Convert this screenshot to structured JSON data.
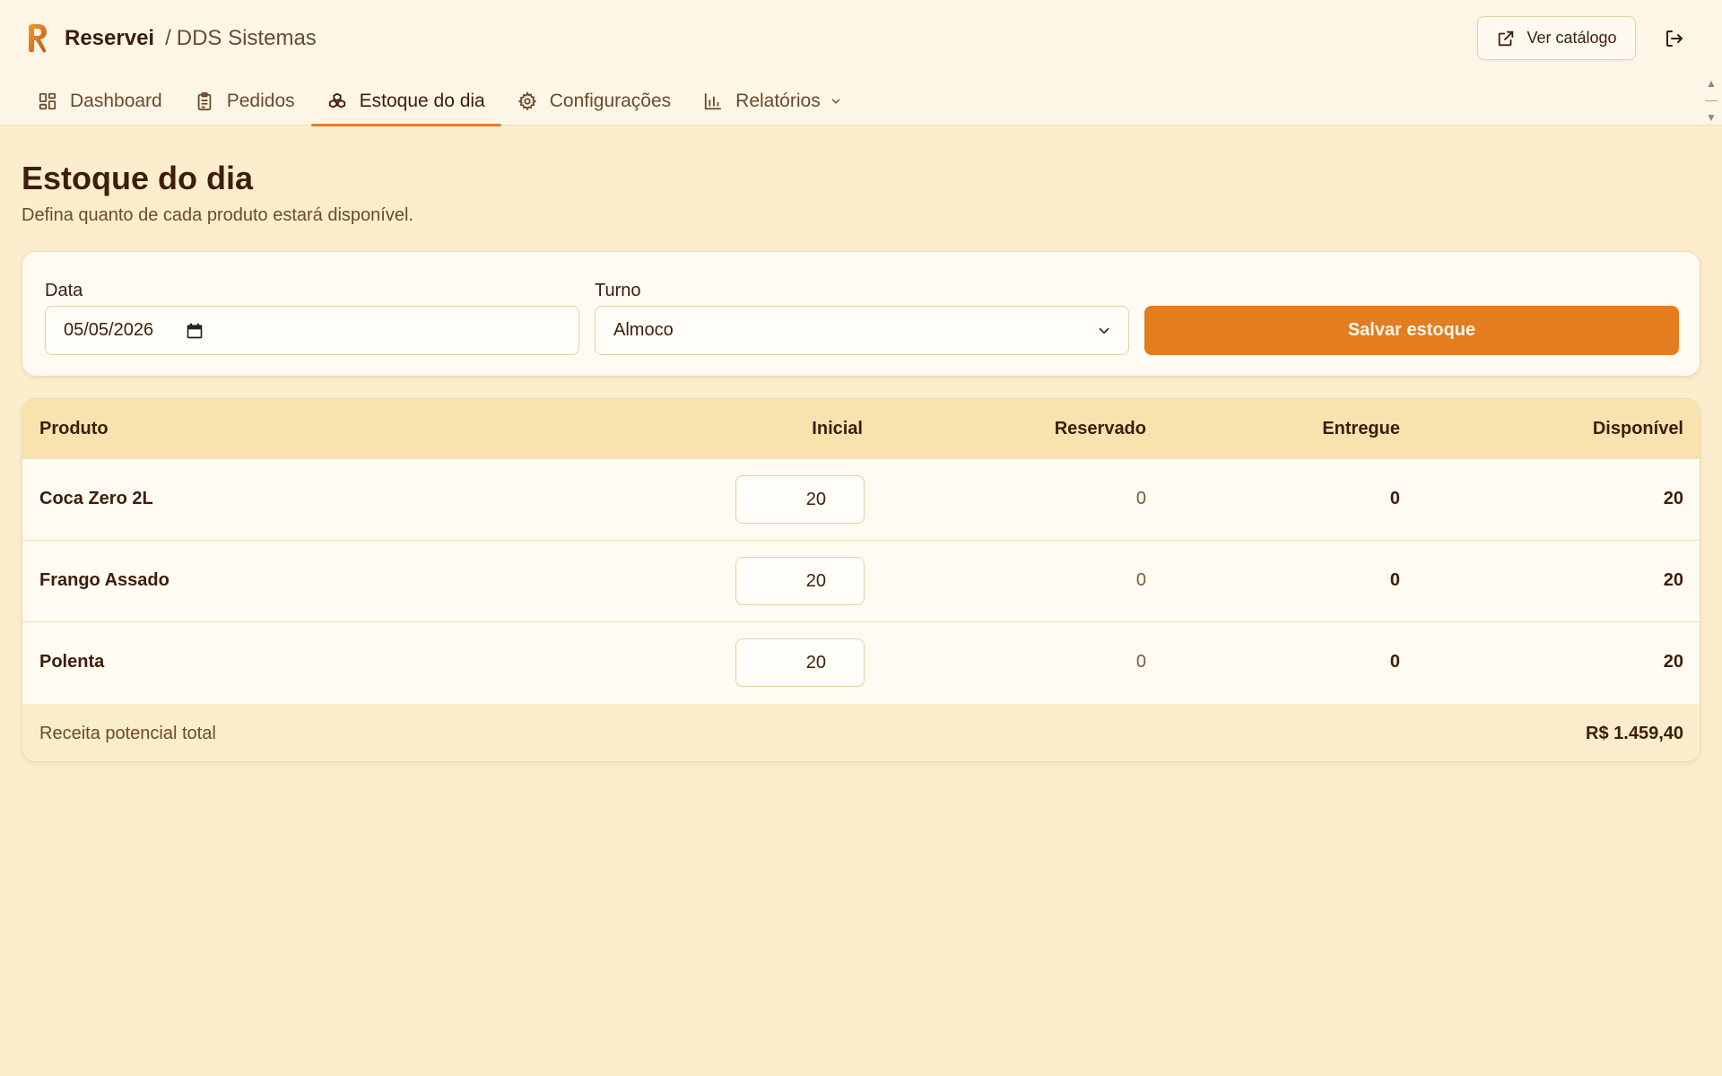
{
  "app": {
    "name": "Reservei",
    "separator": "/",
    "organization": "DDS Sistemas",
    "catalog_button": "Ver catálogo",
    "logo_icon": "reservei-r-logo",
    "logout_icon": "logout-icon"
  },
  "nav": {
    "items": [
      {
        "label": "Dashboard",
        "icon": "grid-icon"
      },
      {
        "label": "Pedidos",
        "icon": "clipboard-icon"
      },
      {
        "label": "Estoque do dia",
        "icon": "boxes-icon",
        "active": true
      },
      {
        "label": "Configurações",
        "icon": "gear-icon"
      },
      {
        "label": "Relatórios",
        "icon": "bar-chart-icon",
        "has_dropdown": true
      }
    ]
  },
  "page": {
    "title": "Estoque do dia",
    "subtitle": "Defina quanto de cada produto estará disponível."
  },
  "filters": {
    "date_label": "Data",
    "date_value": "05/05/2026",
    "shift_label": "Turno",
    "shift_value": "Almoco",
    "save_button": "Salvar estoque"
  },
  "table": {
    "headers": [
      "Produto",
      "Inicial",
      "Reservado",
      "Entregue",
      "Disponível"
    ],
    "rows": [
      {
        "product": "Coca Zero 2L",
        "initial": "20",
        "reserved": "0",
        "delivered": "0",
        "available": "20"
      },
      {
        "product": "Frango Assado",
        "initial": "20",
        "reserved": "0",
        "delivered": "0",
        "available": "20"
      },
      {
        "product": "Polenta",
        "initial": "20",
        "reserved": "0",
        "delivered": "0",
        "available": "20"
      }
    ],
    "footer_label": "Receita potencial total",
    "footer_value": "R$ 1.459,40"
  },
  "colors": {
    "accent": "#e47d20",
    "background": "#fcedcc",
    "header_bg": "#fdf6e6",
    "table_head": "#f8e2ae",
    "text": "#3e1d0a"
  }
}
